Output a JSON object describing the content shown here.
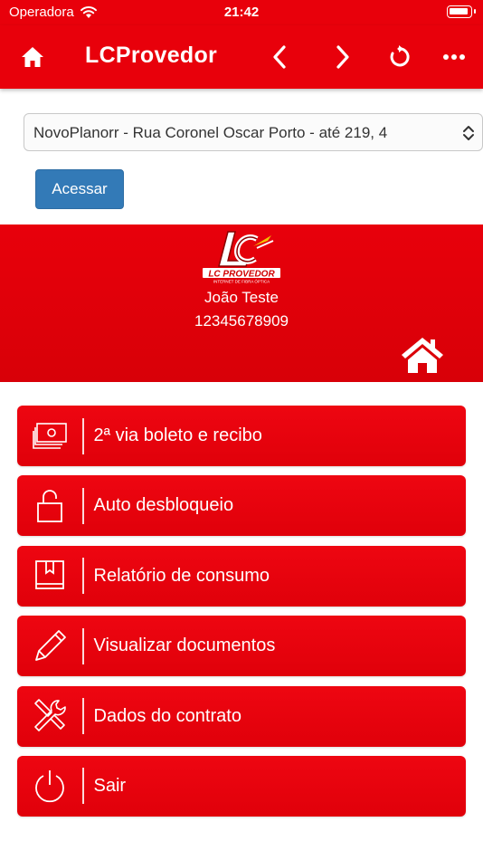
{
  "status_bar": {
    "carrier": "Operadora",
    "time": "21:42"
  },
  "navbar": {
    "title": "LCProvedor",
    "icons": [
      "home-icon",
      "chevron-left-icon",
      "chevron-right-icon",
      "reload-icon",
      "more-icon"
    ]
  },
  "plan_select": {
    "selected": "NovoPlanorr - Rua Coronel Oscar Porto - até 219, 4"
  },
  "access_button": {
    "label": "Acessar"
  },
  "banner": {
    "logo_text": "LC PROVEDOR",
    "logo_subtext": "INTERNET DE FIBRA ÓPTICA",
    "user_name": "João Teste",
    "user_document": "12345678909"
  },
  "menu": {
    "items": [
      {
        "label": "2ª via boleto e recibo",
        "icon": "money-icon"
      },
      {
        "label": "Auto desbloqueio",
        "icon": "unlock-icon"
      },
      {
        "label": "Relatório de consumo",
        "icon": "book-icon"
      },
      {
        "label": "Visualizar documentos",
        "icon": "pencil-icon"
      },
      {
        "label": "Dados do contrato",
        "icon": "tools-icon"
      },
      {
        "label": "Sair",
        "icon": "power-icon"
      }
    ]
  },
  "colors": {
    "brand_red": "#e8000b",
    "button_blue": "#337ab7"
  }
}
